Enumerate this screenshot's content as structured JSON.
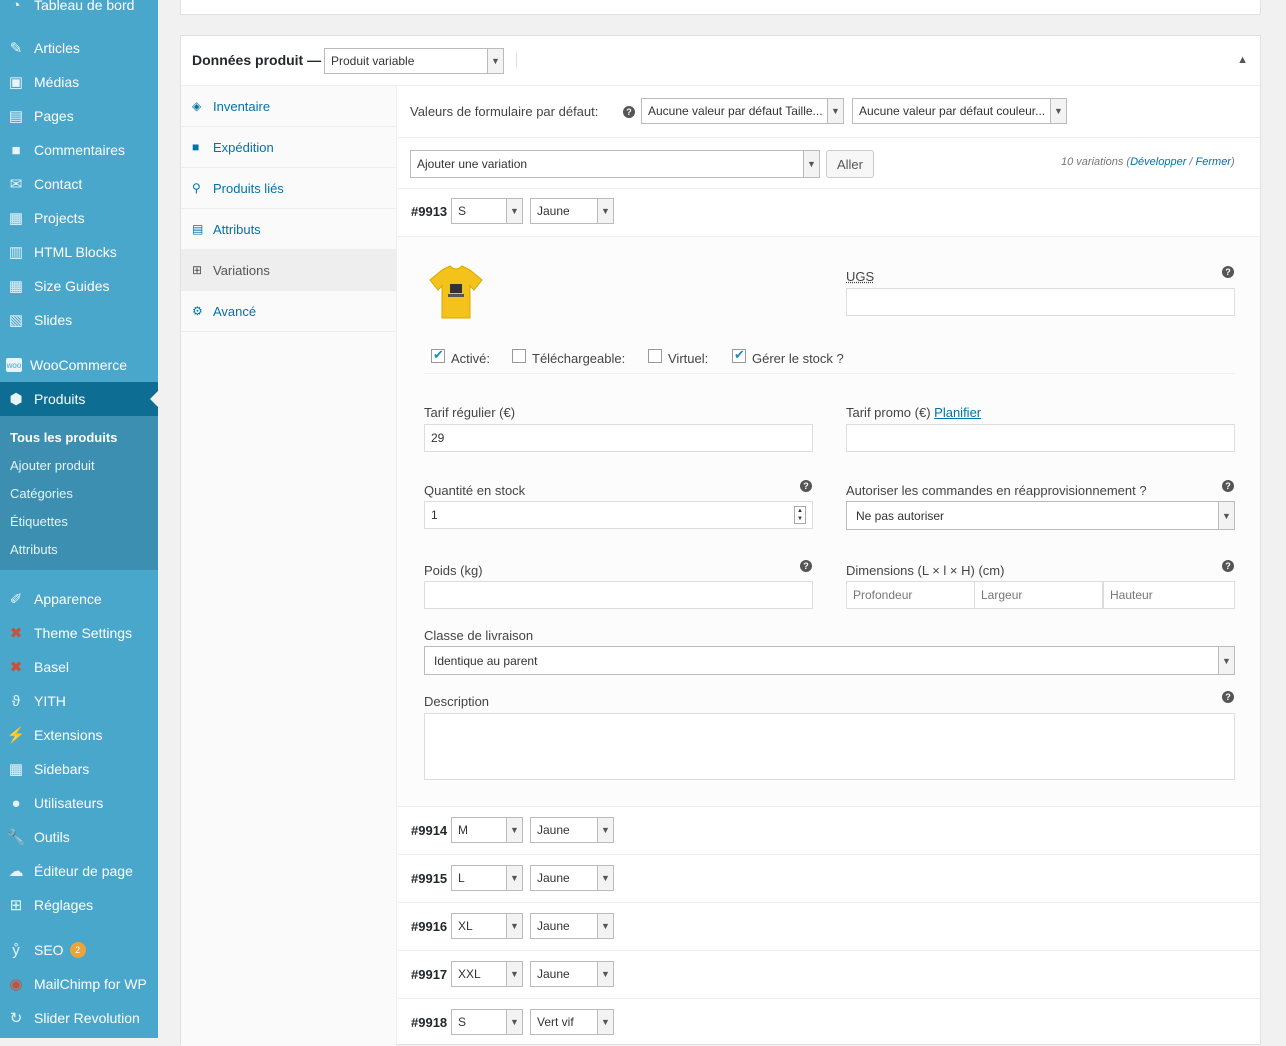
{
  "sidebar": {
    "top_item_partial": "Tableau de bord",
    "items": [
      {
        "label": "Articles",
        "icon": "pin-icon"
      },
      {
        "label": "Médias",
        "icon": "media-icon"
      },
      {
        "label": "Pages",
        "icon": "pages-icon"
      },
      {
        "label": "Commentaires",
        "icon": "comment-icon"
      },
      {
        "label": "Contact",
        "icon": "mail-icon"
      },
      {
        "label": "Projects",
        "icon": "portfolio-icon"
      },
      {
        "label": "HTML Blocks",
        "icon": "grid-icon"
      },
      {
        "label": "Size Guides",
        "icon": "table-icon"
      },
      {
        "label": "Slides",
        "icon": "slides-icon"
      },
      {
        "label": "WooCommerce",
        "icon": "woo-icon"
      },
      {
        "label": "Produits",
        "icon": "box-icon"
      },
      {
        "label": "Apparence",
        "icon": "brush-icon"
      },
      {
        "label": "Theme Settings",
        "icon": "theme-icon"
      },
      {
        "label": "Basel",
        "icon": "basel-icon"
      },
      {
        "label": "YITH",
        "icon": "yith-icon"
      },
      {
        "label": "Extensions",
        "icon": "plugin-icon"
      },
      {
        "label": "Sidebars",
        "icon": "sidebars-icon"
      },
      {
        "label": "Utilisateurs",
        "icon": "user-icon"
      },
      {
        "label": "Outils",
        "icon": "wrench-icon"
      },
      {
        "label": "Éditeur de page",
        "icon": "cloud-icon"
      },
      {
        "label": "Réglages",
        "icon": "settings-icon"
      },
      {
        "label": "SEO",
        "icon": "yoast-icon",
        "badge": "2"
      },
      {
        "label": "MailChimp for WP",
        "icon": "mailchimp-icon"
      },
      {
        "label": "Slider Revolution",
        "icon": "refresh-icon"
      }
    ],
    "submenu": [
      "Tous les produits",
      "Ajouter produit",
      "Catégories",
      "Étiquettes",
      "Attributs"
    ]
  },
  "product": {
    "title": "Données produit —",
    "type_select": "Produit variable"
  },
  "tabs": [
    {
      "label": "Inventaire",
      "icon": "tag-icon"
    },
    {
      "label": "Expédition",
      "icon": "truck-icon"
    },
    {
      "label": "Produits liés",
      "icon": "link-icon"
    },
    {
      "label": "Attributs",
      "icon": "list-icon"
    },
    {
      "label": "Variations",
      "icon": "grid-icon"
    },
    {
      "label": "Avancé",
      "icon": "gear-icon"
    }
  ],
  "defaults": {
    "label": "Valeurs de formulaire par défaut:",
    "size_select": "Aucune valeur par défaut Taille...",
    "color_select": "Aucune valeur par défaut couleur..."
  },
  "add_variation": {
    "select": "Ajouter une variation",
    "go_button": "Aller",
    "count_text": "10 variations (",
    "expand": "Développer",
    "sep": " / ",
    "close": "Fermer",
    "end": ")"
  },
  "variation_open": {
    "id": "#9913",
    "size": "S",
    "color": "Jaune",
    "sku_label": "UGS",
    "enabled_label": "Activé:",
    "downloadable_label": "Téléchargeable:",
    "virtual_label": "Virtuel:",
    "manage_stock_label": "Gérer le stock ?",
    "regular_price_label": "Tarif régulier (€)",
    "regular_price_value": "29",
    "sale_price_label": "Tarif promo (€)",
    "schedule_link": "Planifier",
    "stock_qty_label": "Quantité en stock",
    "stock_qty_value": "1",
    "backorders_label": "Autoriser les commandes en réapprovisionnement ?",
    "backorders_value": "Ne pas autoriser",
    "weight_label": "Poids (kg)",
    "dimensions_label": "Dimensions (L × l × H) (cm)",
    "length_ph": "Profondeur",
    "width_ph": "Largeur",
    "height_ph": "Hauteur",
    "shipping_class_label": "Classe de livraison",
    "shipping_class_value": "Identique au parent",
    "description_label": "Description"
  },
  "variations": [
    {
      "id": "#9914",
      "size": "M",
      "color": "Jaune"
    },
    {
      "id": "#9915",
      "size": "L",
      "color": "Jaune"
    },
    {
      "id": "#9916",
      "size": "XL",
      "color": "Jaune"
    },
    {
      "id": "#9917",
      "size": "XXL",
      "color": "Jaune"
    },
    {
      "id": "#9918",
      "size": "S",
      "color": "Vert vif"
    }
  ],
  "colors": {
    "sidebar": "#4aa7cc",
    "sidebar_active": "#0e6d93",
    "link": "#0073aa",
    "badge": "#e9a43c"
  }
}
